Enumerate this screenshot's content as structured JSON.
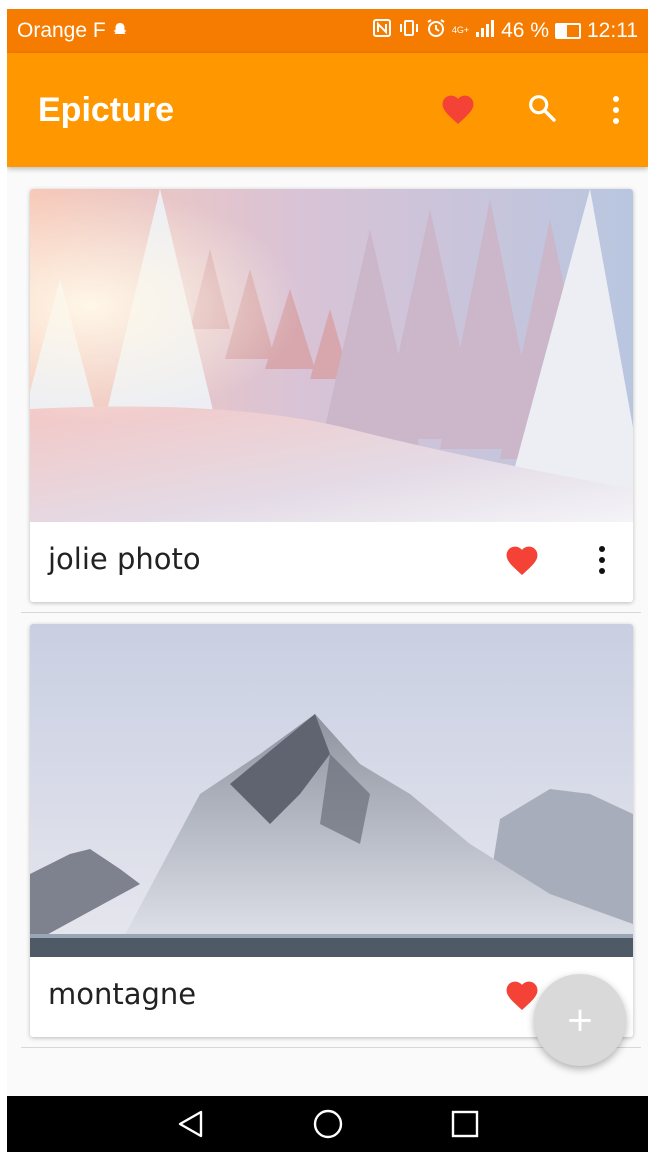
{
  "status_bar": {
    "carrier": "Orange F",
    "battery_percent": "46 %",
    "battery_level": 0.46,
    "time": "12:11",
    "network_label": "4G+"
  },
  "app_bar": {
    "title": "Epicture",
    "icons": [
      "heart-icon",
      "search-icon",
      "overflow-menu-icon"
    ]
  },
  "posts": [
    {
      "title": "jolie photo",
      "favorite": true,
      "image": "snowy-forest"
    },
    {
      "title": "montagne",
      "favorite": true,
      "image": "snowy-mountain"
    }
  ],
  "fab": {
    "label": "+"
  },
  "nav_bar": {
    "icons": [
      "back-icon",
      "home-icon",
      "recents-icon"
    ]
  },
  "colors": {
    "status_bar": "#f57c00",
    "app_bar": "#ff9800",
    "heart": "#f44336",
    "fab": "#d9d9d9"
  }
}
